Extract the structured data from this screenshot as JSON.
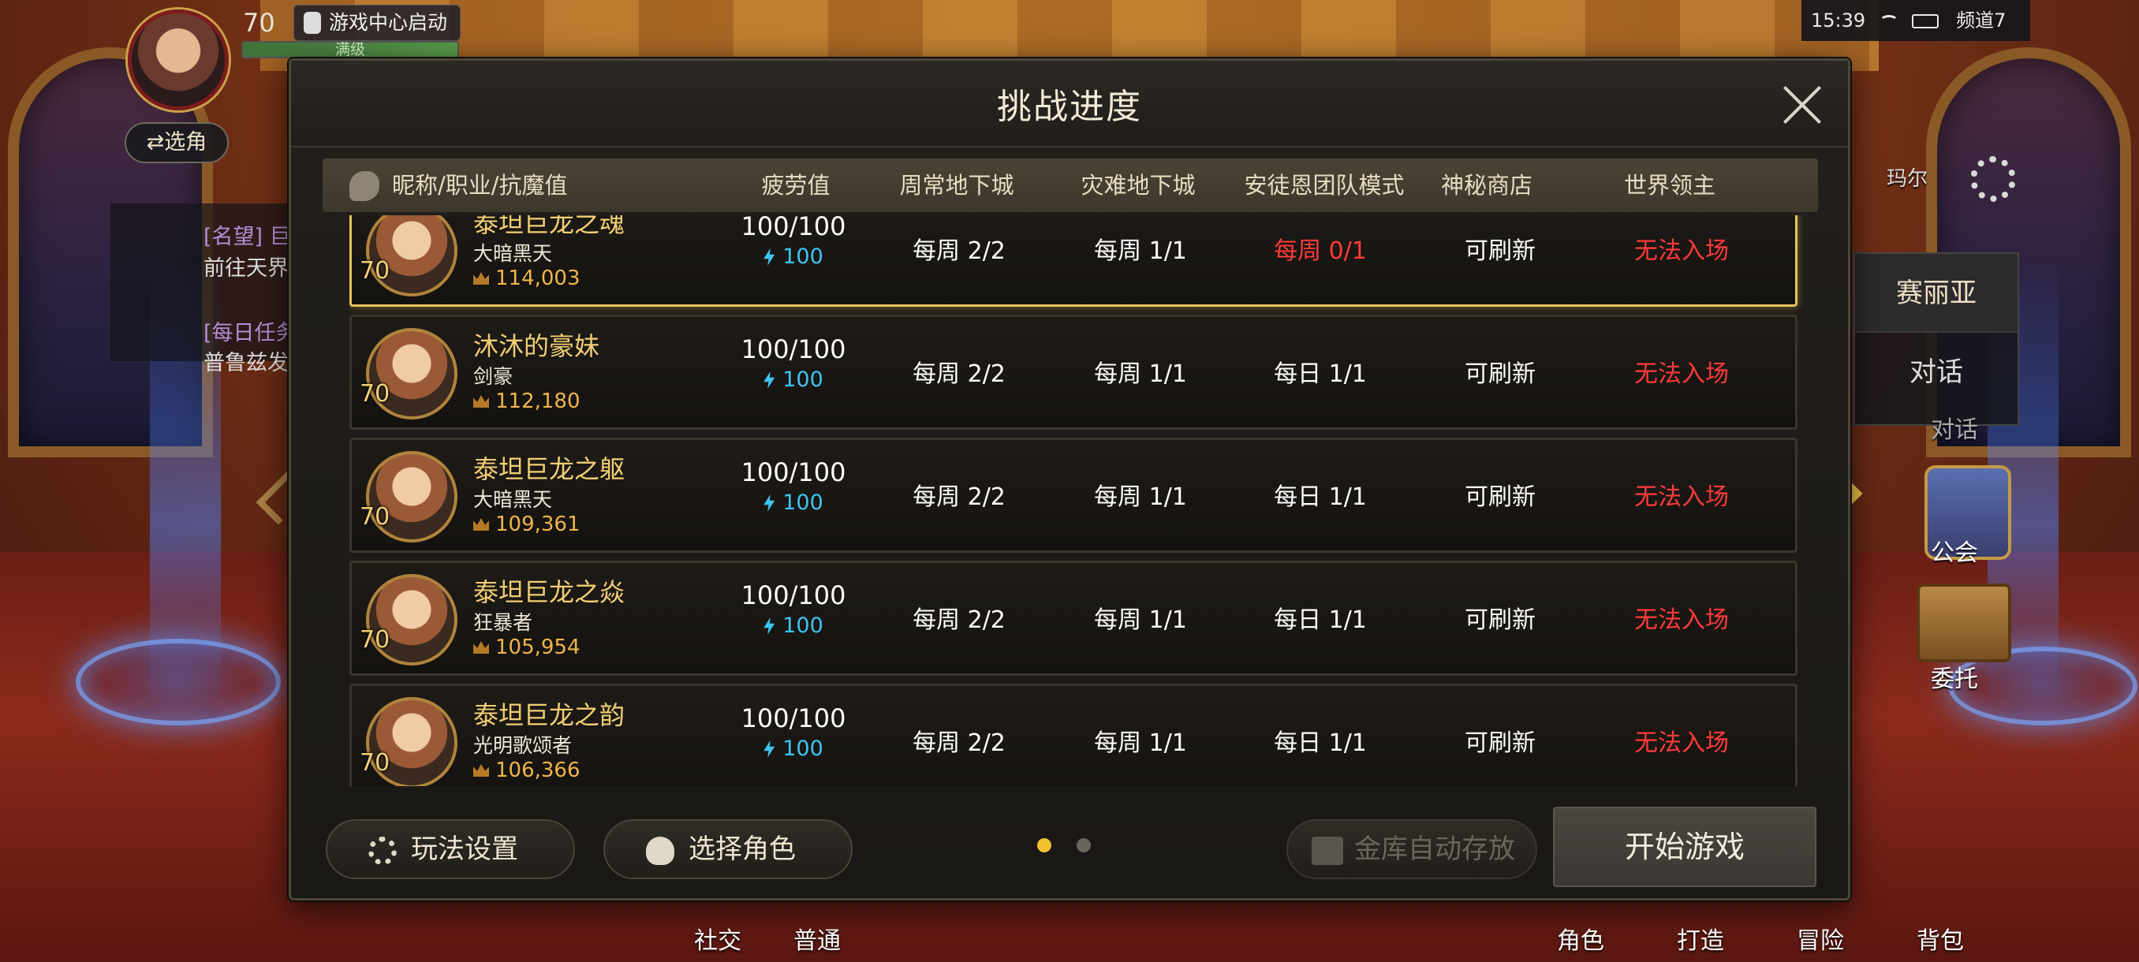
{
  "hud": {
    "level": "70",
    "launch_label": "游戏中心启动",
    "level_status": "满级",
    "select_char": "⇄选角",
    "quest_1_tag": "[名望] 巨",
    "quest_1_desc": "前往天界",
    "quest_2_tag": "[每日任务",
    "quest_2_desc": "普鲁兹发"
  },
  "status_bar": {
    "time": "15:39",
    "channel": "频道7"
  },
  "right_hud": {
    "npc_location": "玛尔",
    "npc_name": "赛丽亚",
    "talk": "对话",
    "talk_shadow": "对话",
    "guild": "公会",
    "entrust": "委托"
  },
  "bottom_menu": {
    "social": "社交",
    "normal": "普通",
    "character": "角色",
    "craft": "打造",
    "adventure": "冒险",
    "bag": "背包"
  },
  "dialog": {
    "title": "挑战进度",
    "columns": [
      "昵称/职业/抗魔值",
      "疲劳值",
      "周常地下城",
      "灾难地下城",
      "安徒恩团队模式",
      "神秘商店",
      "世界领主"
    ],
    "rows": [
      {
        "name": "泰坦巨龙之魂",
        "job": "大暗黑天",
        "power": "114,003",
        "level": "70",
        "fatigue": "100/100",
        "energy": "100",
        "weekly": "每周 2/2",
        "disaster": "每周 1/1",
        "anton": "每周 0/1",
        "anton_red": true,
        "shop": "可刷新",
        "world_boss": "无法入场"
      },
      {
        "name": "沐沐的豪妹",
        "job": "剑豪",
        "power": "112,180",
        "level": "70",
        "fatigue": "100/100",
        "energy": "100",
        "weekly": "每周 2/2",
        "disaster": "每周 1/1",
        "anton": "每日 1/1",
        "anton_red": false,
        "shop": "可刷新",
        "world_boss": "无法入场"
      },
      {
        "name": "泰坦巨龙之躯",
        "job": "大暗黑天",
        "power": "109,361",
        "level": "70",
        "fatigue": "100/100",
        "energy": "100",
        "weekly": "每周 2/2",
        "disaster": "每周 1/1",
        "anton": "每日 1/1",
        "anton_red": false,
        "shop": "可刷新",
        "world_boss": "无法入场"
      },
      {
        "name": "泰坦巨龙之焱",
        "job": "狂暴者",
        "power": "105,954",
        "level": "70",
        "fatigue": "100/100",
        "energy": "100",
        "weekly": "每周 2/2",
        "disaster": "每周 1/1",
        "anton": "每日 1/1",
        "anton_red": false,
        "shop": "可刷新",
        "world_boss": "无法入场"
      },
      {
        "name": "泰坦巨龙之韵",
        "job": "光明歌颂者",
        "power": "106,366",
        "level": "70",
        "fatigue": "100/100",
        "energy": "100",
        "weekly": "每周 2/2",
        "disaster": "每周 1/1",
        "anton": "每日 1/1",
        "anton_red": false,
        "shop": "可刷新",
        "world_boss": "无法入场"
      }
    ],
    "buttons": {
      "play_settings": "玩法设置",
      "select_character": "选择角色",
      "vault_auto_store": "金库自动存放",
      "start_game": "开始游戏"
    },
    "page_dots": {
      "total": 2,
      "active": 1
    }
  },
  "colors": {
    "accent_gold": "#f2cf73",
    "warning_red": "#ff3b3b",
    "energy_blue": "#3ec4f0",
    "selected_border": "#e7c35a"
  },
  "icons": [
    "close-icon",
    "gear-icon",
    "character-icon",
    "vault-icon",
    "chevron-left-icon",
    "chevron-right-icon",
    "lightning-icon",
    "crown-icon"
  ]
}
